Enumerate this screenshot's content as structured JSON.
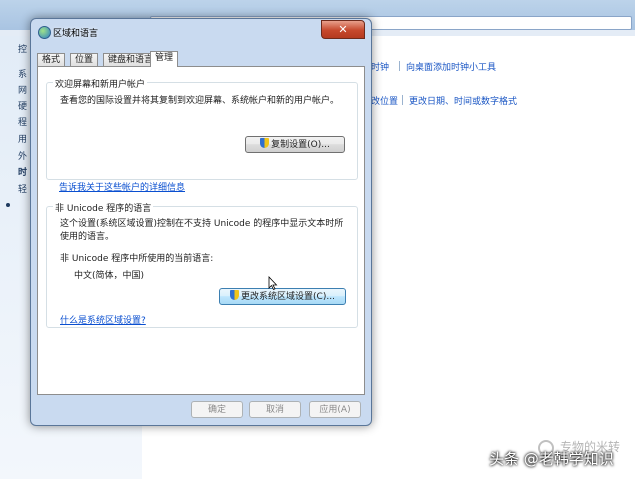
{
  "background": {
    "sidebar_items": [
      "控",
      "系",
      "网",
      "硬",
      "程",
      "用",
      "外",
      "时",
      "轻"
    ],
    "links_row1": [
      "时钟",
      "向桌面添加时钟小工具"
    ],
    "links_row2": [
      "改位置",
      "更改日期、时间或数字格式"
    ]
  },
  "dialog": {
    "title": "区域和语言",
    "close_symbol": "✕",
    "tabs": [
      "格式",
      "位置",
      "键盘和语言",
      "管理"
    ],
    "active_tab": "管理",
    "welcome_group": {
      "title": "欢迎屏幕和新用户帐户",
      "description": "查看您的国际设置并将其复制到欢迎屏幕、系统帐户和新的用户帐户。",
      "copy_button": "复制设置(O)...",
      "link": "告诉我关于这些帐户的详细信息"
    },
    "unicode_group": {
      "title": "非 Unicode 程序的语言",
      "description": "这个设置(系统区域设置)控制在不支持 Unicode 的程序中显示文本时所使用的语言。",
      "current_label": "非 Unicode 程序中所使用的当前语言:",
      "current_value": "中文(简体，中国)",
      "change_button": "更改系统区域设置(C)...",
      "link": "什么是系统区域设置?"
    },
    "buttons": {
      "ok": "确定",
      "cancel": "取消",
      "apply": "应用(A)"
    }
  },
  "watermark": {
    "small": "专物的米转",
    "main": "头条 @老韩学知识"
  }
}
